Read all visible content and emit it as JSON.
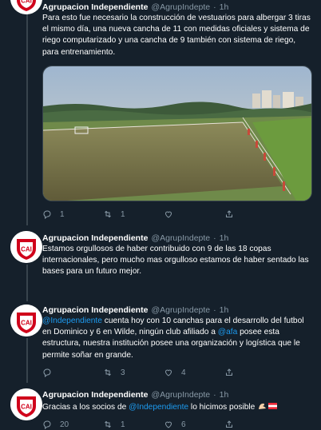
{
  "author": {
    "name": "Agrupacion Independiente",
    "handle": "@AgrupIndepte"
  },
  "separator": "·",
  "tweets": [
    {
      "time": "1h",
      "text": "Para esto fue necesario la construcción de vestuarios para albergar 3 tiras el mismo día, una nueva cancha de 11 con medidas oficiales y sistema de riego computarizado y una cancha de 9 también con sistema de riego, para entrenamiento.",
      "replies": "1",
      "retweets": "1",
      "likes": "",
      "has_media": true
    },
    {
      "time": "1h",
      "text": "Estamos orgullosos de haber contribuido con 9 de las 18 copas internacionales, pero mucho mas orgulloso estamos de haber sentado las bases para un futuro mejor.",
      "replies": "",
      "retweets": "",
      "likes": ""
    },
    {
      "time": "1h",
      "mention1": "@Independiente",
      "text_a": " cuenta hoy con 10 canchas para el desarrollo del futbol en Dominico y 6 en Wilde, ningún club afiliado a ",
      "mention2": "@afa",
      "text_b": " posee esta estructura, nuestra institución posee una organización y logística que le permite soñar en grande.",
      "replies": "",
      "retweets": "3",
      "likes": "4"
    },
    {
      "time": "1h",
      "text_a": "Gracias a los socios de ",
      "mention1": "@Independiente",
      "text_b": "  lo hicimos posible ",
      "emoji": "💪🇦🇹",
      "replies": "20",
      "retweets": "1",
      "likes": "6"
    }
  ],
  "icons": {
    "reply": "reply-icon",
    "retweet": "retweet-icon",
    "like": "heart-icon",
    "share": "share-icon",
    "avatar": "club-crest-avatar"
  },
  "colors": {
    "background": "#15202b",
    "text": "#ffffff",
    "secondary": "#8899a6",
    "mention": "#1d9bf0",
    "crest_red": "#d0021b"
  }
}
